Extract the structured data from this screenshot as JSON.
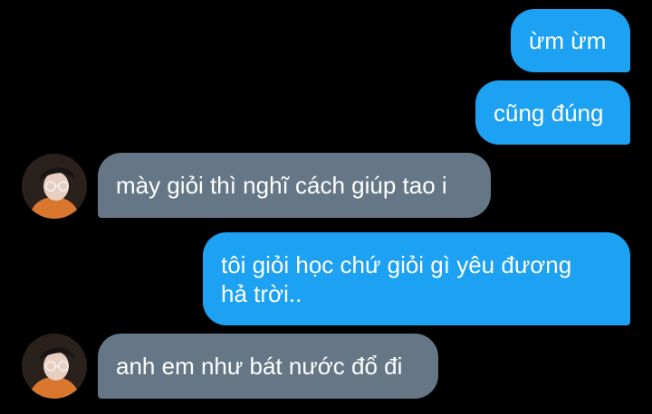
{
  "colors": {
    "background": "#000000",
    "sent_bubble": "#1DA1F2",
    "received_bubble": "#657786",
    "text": "#ffffff"
  },
  "messages": [
    {
      "direction": "sent",
      "text": "ừm ừm"
    },
    {
      "direction": "sent",
      "text": "cũng đúng"
    },
    {
      "direction": "received",
      "text": "mày giỏi thì nghĩ cách giúp tao i",
      "avatar": "user-avatar-photo"
    },
    {
      "direction": "sent",
      "lines": [
        "tôi giỏi học chứ giỏi gì yêu đương",
        "hả trời.."
      ]
    },
    {
      "direction": "received",
      "text": "anh em như bát nước đổ đi",
      "avatar": "user-avatar-photo"
    }
  ]
}
